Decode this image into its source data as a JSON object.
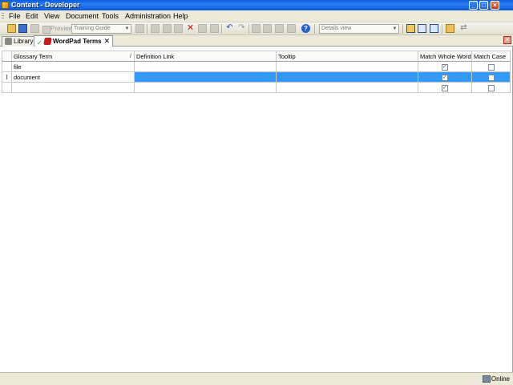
{
  "window": {
    "title": "Content - Developer"
  },
  "menu": {
    "items": [
      "File",
      "Edit",
      "View",
      "Document",
      "Tools",
      "Administration",
      "Help"
    ]
  },
  "toolbar": {
    "preview_label": "Preview",
    "outline_combo": "Training Guide",
    "view_combo": "Details view"
  },
  "tabs": [
    {
      "label": "Library"
    },
    {
      "label": "WordPad Terms"
    }
  ],
  "grid": {
    "sort_indicator": "/",
    "columns": [
      "Glossary Term",
      "Definition Link",
      "Tooltip",
      "Match Whole Word",
      "Match Case"
    ],
    "rows": [
      {
        "term": "file",
        "definition": "",
        "tooltip": "",
        "match_whole_word": true,
        "match_case": false
      },
      {
        "term": "document",
        "definition": "",
        "tooltip": "",
        "match_whole_word": true,
        "match_case": false,
        "selected": true,
        "indicator": "I"
      },
      {
        "term": "",
        "definition": "",
        "tooltip": "",
        "match_whole_word": true,
        "match_case": false
      }
    ]
  },
  "status": {
    "connection": "Online"
  }
}
